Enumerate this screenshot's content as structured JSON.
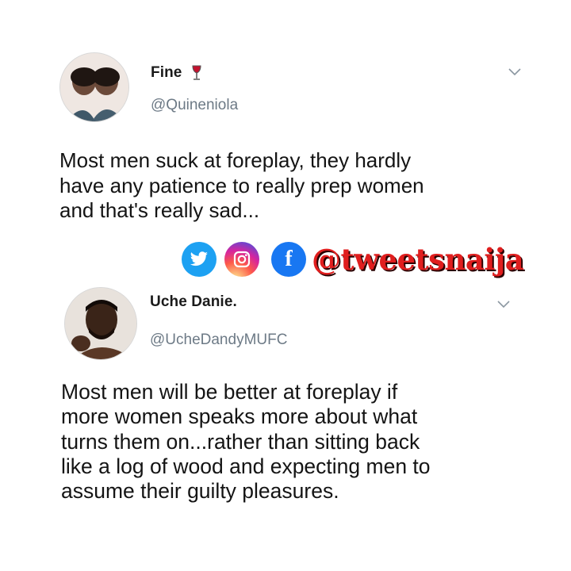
{
  "tweets": [
    {
      "display_name": "Fine",
      "handle": "@Quineniola",
      "text": "Most men suck at foreplay, they hardly\nhave any patience to really prep women\nand that's really sad...",
      "name_emoji": "wine-glass-icon"
    },
    {
      "display_name": "Uche Danie.",
      "handle": "@UcheDandyMUFC",
      "text": "Most men will be better at foreplay if\nmore women speaks more about what\nturns them on...rather than sitting back\nlike a log of wood and expecting men to\nassume their guilty pleasures."
    }
  ],
  "watermark": {
    "handle": "@tweetsnaija",
    "icons": [
      "twitter-icon",
      "instagram-icon",
      "facebook-icon"
    ],
    "colors": {
      "twitter": "#1da1f2",
      "facebook": "#1877f2",
      "text": "#e01e1e"
    }
  },
  "colors": {
    "handle": "#6d7a86",
    "text": "#141414",
    "background": "#ffffff"
  }
}
